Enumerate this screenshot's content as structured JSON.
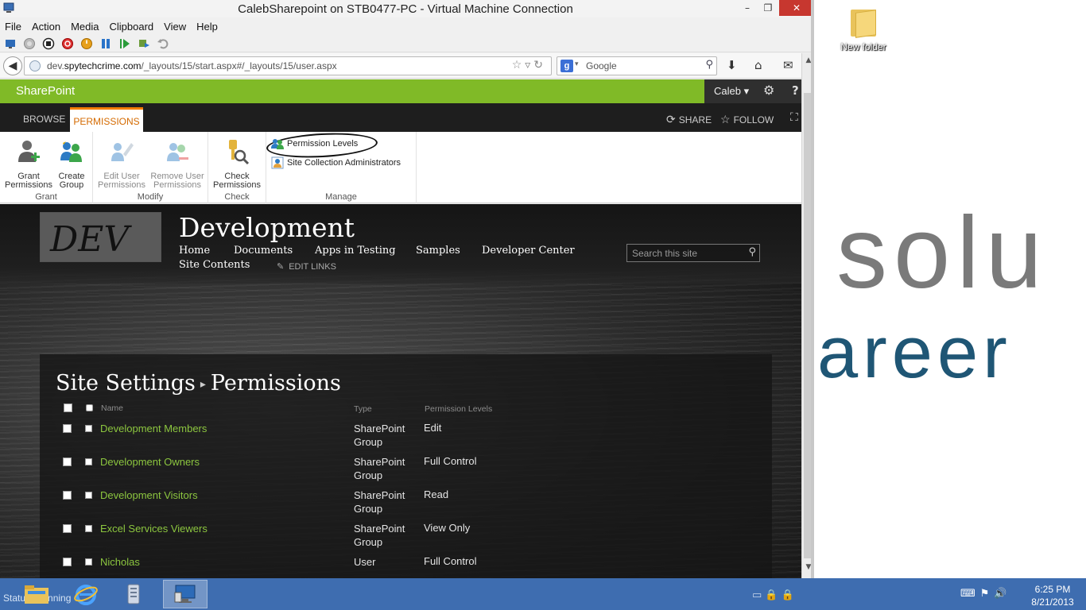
{
  "vm": {
    "title": "CalebSharepoint on STB0477-PC - Virtual Machine Connection",
    "menu": [
      "File",
      "Action",
      "Media",
      "Clipboard",
      "View",
      "Help"
    ],
    "controls": {
      "minimize": "–",
      "restore": "❐",
      "close": "✕"
    }
  },
  "browser": {
    "url_domain_prefix": "dev.",
    "url_domain_main": "spytechcrime.com",
    "url_path": "/_layouts/15/start.aspx#/_layouts/15/user.aspx",
    "search_engine": "Google",
    "search_placeholder": "Google"
  },
  "suitebar": {
    "brand": "SharePoint",
    "user": "Caleb ▾"
  },
  "ribbon": {
    "tabs": {
      "browse": "BROWSE",
      "permissions": "PERMISSIONS"
    },
    "share": "SHARE",
    "follow": "FOLLOW",
    "groups": {
      "grant": "Grant",
      "modify": "Modify",
      "check": "Check",
      "manage": "Manage"
    },
    "buttons": {
      "grant_permissions": [
        "Grant",
        "Permissions"
      ],
      "create_group": [
        "Create",
        "Group"
      ],
      "edit_user_permissions": [
        "Edit User",
        "Permissions"
      ],
      "remove_user_permissions": [
        "Remove User",
        "Permissions"
      ],
      "check_permissions": [
        "Check",
        "Permissions"
      ],
      "permission_levels": "Permission Levels",
      "site_collection_admins": "Site Collection Administrators"
    }
  },
  "site": {
    "logo_text": "DEV",
    "title": "Development",
    "nav": {
      "home": "Home",
      "documents": "Documents",
      "apps_in_testing": "Apps in Testing",
      "samples": "Samples",
      "developer_center": "Developer Center",
      "site_contents": "Site Contents"
    },
    "edit_links": "EDIT LINKS",
    "search_placeholder": "Search this site"
  },
  "page": {
    "breadcrumb_parent": "Site Settings",
    "breadcrumb_separator": "▸",
    "title": "Permissions",
    "columns": {
      "name": "Name",
      "type": "Type",
      "permission_levels": "Permission Levels"
    },
    "rows": [
      {
        "name": "Development Members",
        "type": "SharePoint Group",
        "permission": "Edit"
      },
      {
        "name": "Development Owners",
        "type": "SharePoint Group",
        "permission": "Full Control"
      },
      {
        "name": "Development Visitors",
        "type": "SharePoint Group",
        "permission": "Read"
      },
      {
        "name": "Excel Services Viewers",
        "type": "SharePoint Group",
        "permission": "View Only"
      },
      {
        "name": "Nicholas",
        "type": "User",
        "permission": "Full Control"
      }
    ]
  },
  "desktop": {
    "folder_label": "New folder",
    "wallpaper_line1": "solu",
    "wallpaper_line2": "areer"
  },
  "taskbar": {
    "status_text": "Status: Running",
    "time": "6:25 PM",
    "date": "8/21/2013"
  },
  "colors": {
    "sharepoint_green": "#80ba27",
    "ribbon_orange": "#f27d00",
    "link_green": "#8cc63f",
    "taskbar_blue": "#3e6db0"
  }
}
